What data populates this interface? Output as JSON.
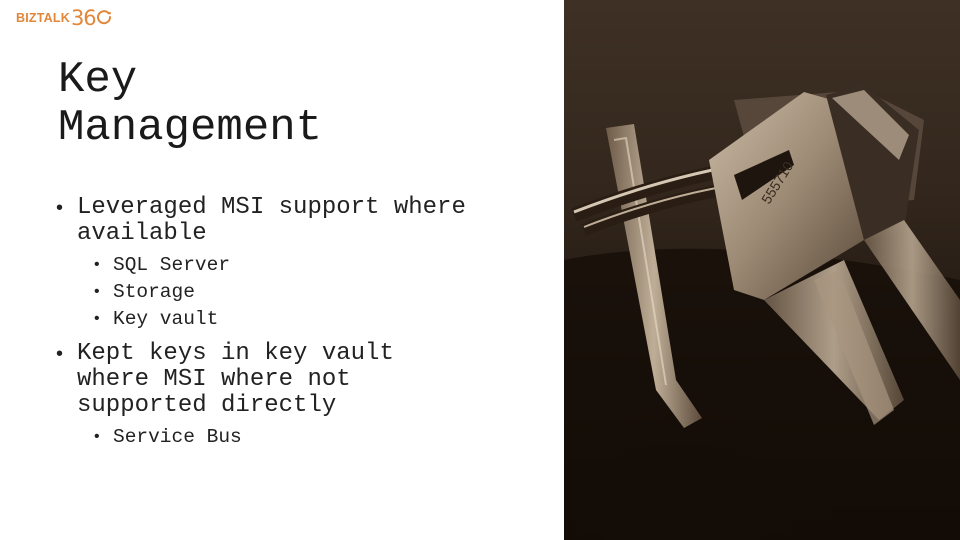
{
  "logo": {
    "brand": "BIZTALK",
    "number": "36",
    "color": "#e2873a"
  },
  "slide": {
    "title_line1": "Key",
    "title_line2": "Management",
    "bullets": [
      {
        "text_lines": [
          "Leveraged MSI support where",
          "available"
        ],
        "subitems": [
          "SQL Server",
          "Storage",
          "Key vault"
        ]
      },
      {
        "text_lines": [
          "Kept keys in key vault",
          "where MSI where not",
          "supported directly"
        ],
        "subitems": [
          "Service Bus"
        ]
      }
    ],
    "bullet_glyph": "•"
  },
  "photo": {
    "subject": "keys-on-keyring-sepia-photo",
    "key_engraving": "555710"
  }
}
